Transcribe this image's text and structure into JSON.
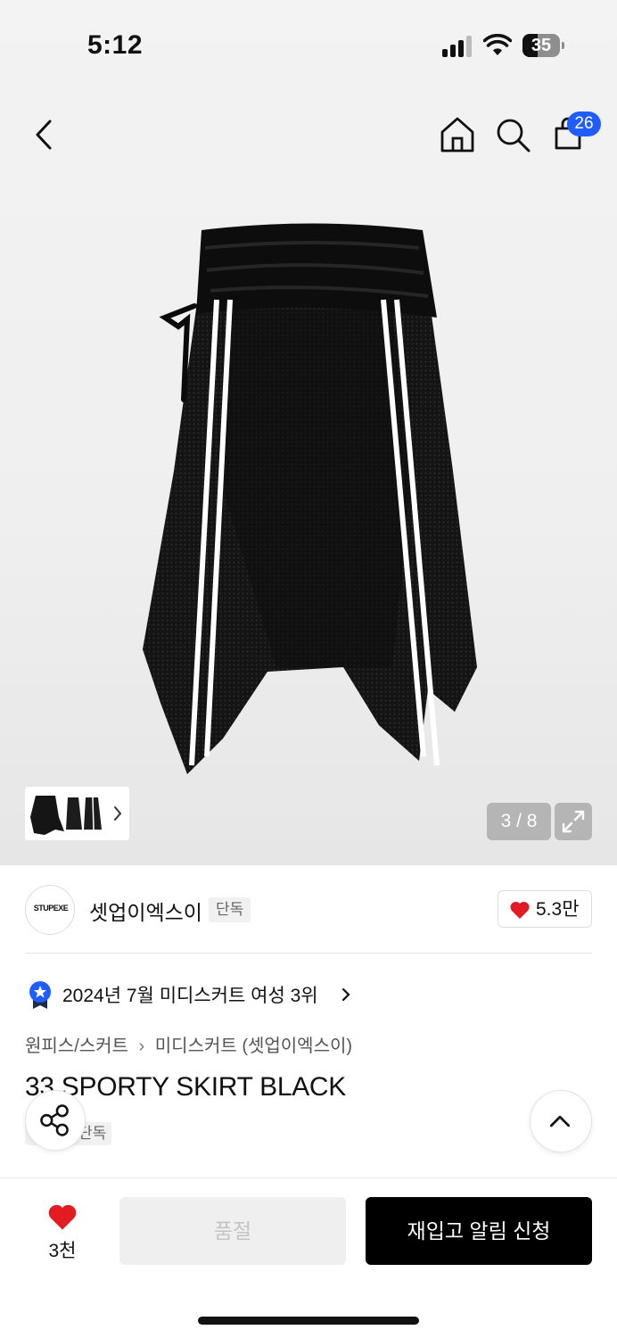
{
  "status_bar": {
    "time": "5:12",
    "battery": "35"
  },
  "header": {
    "cart_count": "26",
    "icons": [
      "back-icon",
      "home-icon",
      "search-icon",
      "shopping-bag-icon"
    ]
  },
  "gallery": {
    "pager": "3 / 8",
    "current_index": 3,
    "total": 8
  },
  "brand": {
    "logo_text": "STUPEXE",
    "name": "셋업이엑스이",
    "tag": "단독",
    "likes": "5.3만"
  },
  "ranking": {
    "text": "2024년 7월 미디스커트 여성 3위"
  },
  "breadcrumb": {
    "category": "원피스/스커트",
    "subcategory": "미디스커트 (셋업이엑스이)"
  },
  "product": {
    "title": "33 SPORTY SKIRT BLACK",
    "tag": "단독"
  },
  "bottom_bar": {
    "wish_count": "3천",
    "soldout_label": "품절",
    "restock_label": "재입고 알림 신청"
  },
  "colors": {
    "accent": "#1f5dff",
    "heart": "#e31b23",
    "primary_button": "#000000"
  }
}
